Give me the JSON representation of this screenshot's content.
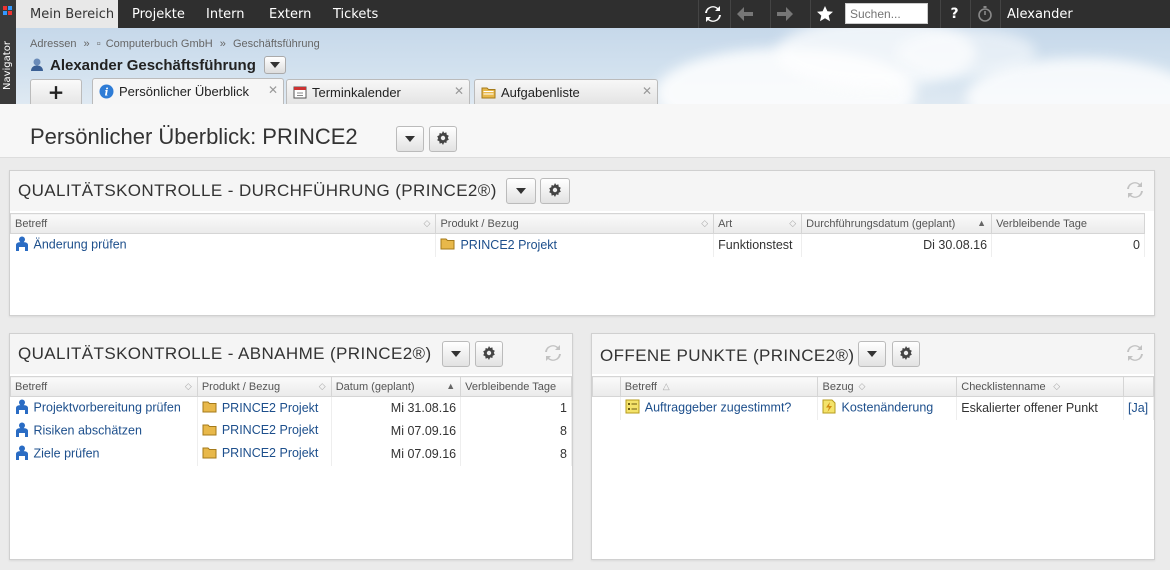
{
  "topbar": {
    "navigator_label": "Navigator",
    "tabs": [
      "Mein Bereich",
      "Projekte",
      "Intern",
      "Extern",
      "Tickets"
    ],
    "search_placeholder": "Suchen...",
    "help_label": "?",
    "user_name": "Alexander Geschäftsführung"
  },
  "header": {
    "breadcrumb": [
      "Adressen",
      "»",
      "Computerbuch GmbH",
      "»",
      "Geschäftsführung"
    ],
    "entity_title": "Alexander Geschäftsführung",
    "add_tab_label": "+",
    "tabs": [
      {
        "label": "Persönlicher Überblick",
        "icon": "info-icon",
        "active": true
      },
      {
        "label": "Terminkalender",
        "icon": "calendar-icon",
        "active": false
      },
      {
        "label": "Aufgabenliste",
        "icon": "folder-icon",
        "active": false
      }
    ],
    "close_glyph": "✕"
  },
  "page": {
    "title": "Persönlicher Überblick: PRINCE2"
  },
  "panel_durchfuehrung": {
    "title": "QUALITÄTSKONTROLLE - DURCHFÜHRUNG (PRINCE2®)",
    "columns": [
      "Betreff",
      "Produkt / Bezug",
      "Art",
      "Durchführungsdatum (geplant)",
      "Verbleibende Tage"
    ],
    "rows": [
      {
        "betreff": "Änderung prüfen",
        "produkt": "PRINCE2 Projekt",
        "art": "Funktionstest",
        "datum": "Di 30.08.16",
        "tage": "0"
      }
    ]
  },
  "panel_abnahme": {
    "title": "QUALITÄTSKONTROLLE - ABNAHME (PRINCE2®)",
    "columns": [
      "Betreff",
      "Produkt / Bezug",
      "Datum (geplant)",
      "Verbleibende Tage"
    ],
    "rows": [
      {
        "betreff": "Projektvorbereitung prüfen",
        "produkt": "PRINCE2 Projekt",
        "datum": "Mi 31.08.16",
        "tage": "1"
      },
      {
        "betreff": "Risiken abschätzen",
        "produkt": "PRINCE2 Projekt",
        "datum": "Mi 07.09.16",
        "tage": "8"
      },
      {
        "betreff": "Ziele prüfen",
        "produkt": "PRINCE2 Projekt",
        "datum": "Mi 07.09.16",
        "tage": "8"
      }
    ]
  },
  "panel_offen": {
    "title": "OFFENE PUNKTE (PRINCE2®)",
    "columns": [
      "Betreff",
      "Bezug",
      "Checklistenname",
      ""
    ],
    "rows": [
      {
        "betreff": "Auftraggeber zugestimmt?",
        "bezug": "Kostenänderung",
        "checkliste": "Eskalierter offener Punkt",
        "flag": "[Ja]"
      }
    ]
  },
  "colors": {
    "link": "#1d4f8c",
    "topbar": "#2f2f2f",
    "folder": "#e8b84a",
    "person": "#2a6cc4"
  }
}
